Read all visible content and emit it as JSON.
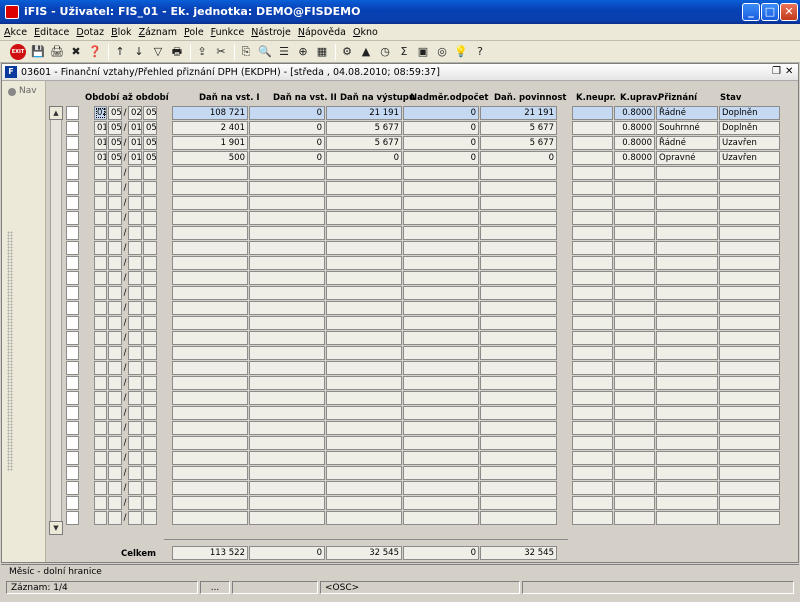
{
  "window": {
    "title": "iFIS - Uživatel: FIS_01 - Ek. jednotka: DEMO@FISDEMO"
  },
  "menu": [
    "Akce",
    "Editace",
    "Dotaz",
    "Blok",
    "Záznam",
    "Pole",
    "Funkce",
    "Nástroje",
    "Nápověda",
    "Okno"
  ],
  "toolbar": {
    "exit_label": "EXIT",
    "icons": [
      "save-icon",
      "print-icon",
      "delete-icon",
      "query-icon",
      "sort-asc-icon",
      "sort-desc-icon",
      "filter-icon",
      "printer-icon",
      "export-icon",
      "cut-icon",
      "copy-icon",
      "search-icon",
      "list-icon",
      "zoom-icon",
      "calculator-icon",
      "settings-icon",
      "chart-icon",
      "clock-icon",
      "sum-icon",
      "excel-icon",
      "browser-icon",
      "lightbulb-icon",
      "help-icon"
    ]
  },
  "form": {
    "title": "03601 - Finanční vztahy/Přehled přiznání DPH (EKDPH) - [středa , 04.08.2010; 08:59:37]",
    "nav_label": "Nav"
  },
  "columns": {
    "obdobi": "Období až období",
    "dan_vst_1": "Daň na vst. I",
    "dan_vst_2": "Daň na vst. II",
    "dan_vystup": "Daň na výstupu",
    "nadmerny": "Nadměr.odpočet",
    "povinnost": "Daň. povinnost",
    "k_neupr": "K.neupr.",
    "k_uprav": "K.uprav.",
    "priznani": "Přiznání",
    "stav": "Stav"
  },
  "rows": [
    {
      "m1": "02",
      "y1": "05",
      "m2": "02",
      "y2": "05",
      "vst1": "108 721",
      "vst2": "0",
      "vystup": "21 191",
      "nadmer": "0",
      "povinnost": "21 191",
      "kneupr": "",
      "kuprav": "0.8000",
      "priznani": "Řádné",
      "stav": "Doplněn"
    },
    {
      "m1": "01",
      "y1": "05",
      "m2": "01",
      "y2": "05",
      "vst1": "2 401",
      "vst2": "0",
      "vystup": "5 677",
      "nadmer": "0",
      "povinnost": "5 677",
      "kneupr": "",
      "kuprav": "0.8000",
      "priznani": "Souhrnné",
      "stav": "Doplněn"
    },
    {
      "m1": "01",
      "y1": "05",
      "m2": "01",
      "y2": "05",
      "vst1": "1 901",
      "vst2": "0",
      "vystup": "5 677",
      "nadmer": "0",
      "povinnost": "5 677",
      "kneupr": "",
      "kuprav": "0.8000",
      "priznani": "Řádné",
      "stav": "Uzavřen"
    },
    {
      "m1": "01",
      "y1": "05",
      "m2": "01",
      "y2": "05",
      "vst1": "500",
      "vst2": "0",
      "vystup": "0",
      "nadmer": "0",
      "povinnost": "0",
      "kneupr": "",
      "kuprav": "0.8000",
      "priznani": "Opravné",
      "stav": "Uzavřen"
    }
  ],
  "totals": {
    "label": "Celkem",
    "vst1": "113 522",
    "vst2": "0",
    "vystup": "32 545",
    "nadmer": "0",
    "povinnost": "32 545"
  },
  "status": {
    "hint": "Měsíc - dolní hranice",
    "record": "Záznam: 1/4",
    "ellipsis": "...",
    "osc": "<OSC>"
  }
}
